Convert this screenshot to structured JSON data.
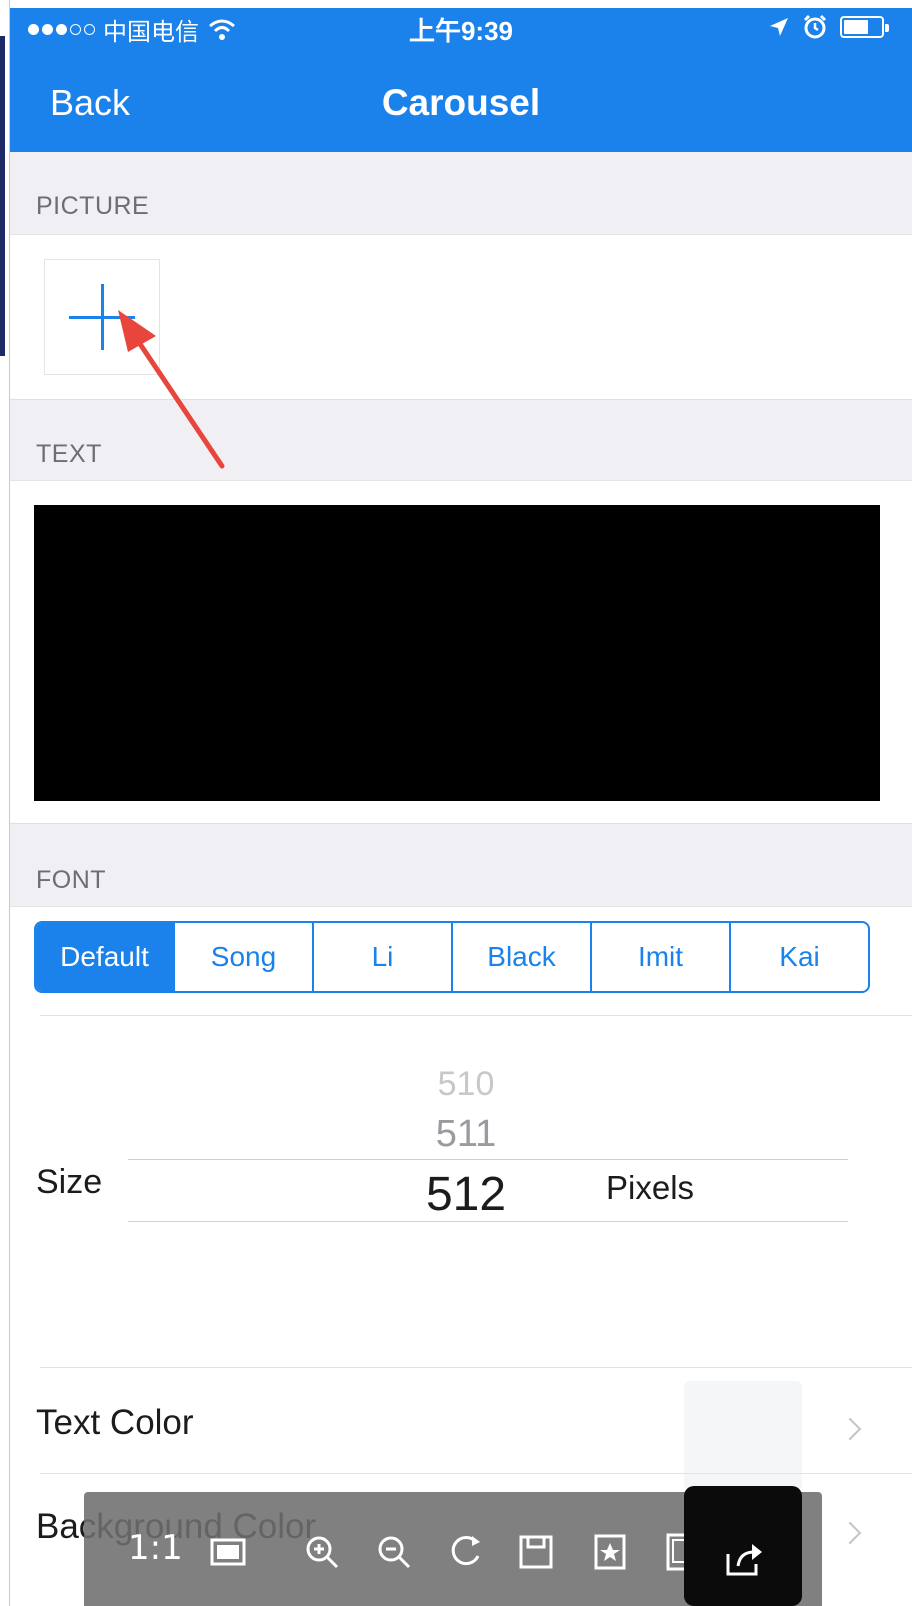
{
  "status_bar": {
    "carrier": "中国电信",
    "time": "上午9:39"
  },
  "nav": {
    "back_label": "Back",
    "title": "Carousel"
  },
  "sections": {
    "picture": "PICTURE",
    "text": "TEXT",
    "font": "FONT"
  },
  "font_options": [
    {
      "label": "Default",
      "selected": true
    },
    {
      "label": "Song",
      "selected": false
    },
    {
      "label": "Li",
      "selected": false
    },
    {
      "label": "Black",
      "selected": false
    },
    {
      "label": "Imit",
      "selected": false
    },
    {
      "label": "Kai",
      "selected": false
    }
  ],
  "size": {
    "label": "Size",
    "picker_values": [
      "510",
      "511",
      "512"
    ],
    "selected_value": "512",
    "unit": "Pixels"
  },
  "rows": {
    "text_color": "Text Color",
    "background_color": "Background Color"
  },
  "viewer_toolbar": {
    "ratio_label": "1:1"
  },
  "colors": {
    "accent": "#1a82ea",
    "annotation_arrow": "#e8453c",
    "text_area_background": "#000000"
  }
}
